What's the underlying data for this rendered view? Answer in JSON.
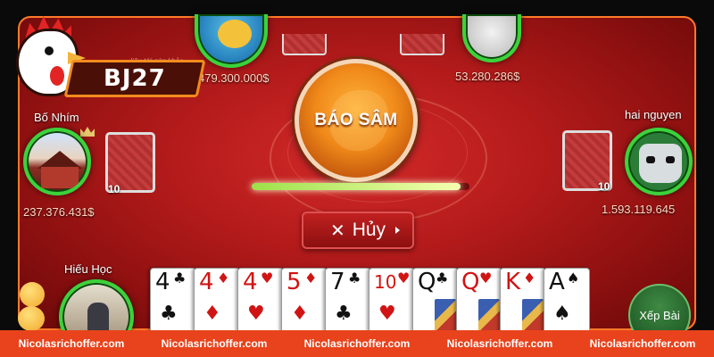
{
  "brand": {
    "badge_text": "BJ27",
    "logo_icon": "rooster-icon"
  },
  "table": {
    "faint_text": "...liêu tới sức khỏe."
  },
  "players": {
    "top_left": {
      "money": "479.300.000$"
    },
    "top_right": {
      "money": "53.280.286$"
    },
    "left": {
      "name": "Bố Nhím",
      "money": "237.376.431$",
      "card_count": "10"
    },
    "right": {
      "name": "hai nguyen",
      "money": "1.593.119.645",
      "card_count": "10"
    },
    "bottom": {
      "name": "Hiếu Học"
    }
  },
  "actions": {
    "bao_sam_label": "BÁO SÂM",
    "cancel_label": "Hủy",
    "sort_label": "Xếp Bài"
  },
  "timer": {
    "progress": 0.96
  },
  "hand": [
    {
      "rank": "4",
      "suit": "♣",
      "color": "black"
    },
    {
      "rank": "4",
      "suit": "♦",
      "color": "red"
    },
    {
      "rank": "4",
      "suit": "♥",
      "color": "red"
    },
    {
      "rank": "5",
      "suit": "♦",
      "color": "red"
    },
    {
      "rank": "7",
      "suit": "♣",
      "color": "black"
    },
    {
      "rank": "10",
      "suit": "♥",
      "color": "red"
    },
    {
      "rank": "Q",
      "suit": "♣",
      "color": "black"
    },
    {
      "rank": "Q",
      "suit": "♥",
      "color": "red"
    },
    {
      "rank": "K",
      "suit": "♦",
      "color": "red"
    },
    {
      "rank": "A",
      "suit": "♠",
      "color": "black"
    }
  ],
  "footer": {
    "watermarks": [
      "Nicolasrichoffer.com",
      "Nicolasrichoffer.com",
      "Nicolasrichoffer.com",
      "Nicolasrichoffer.com",
      "Nicolasrichoffer.com"
    ]
  },
  "colors": {
    "accent": "#f28b1e",
    "table": "#b51b1b",
    "footer": "#e8431c"
  }
}
